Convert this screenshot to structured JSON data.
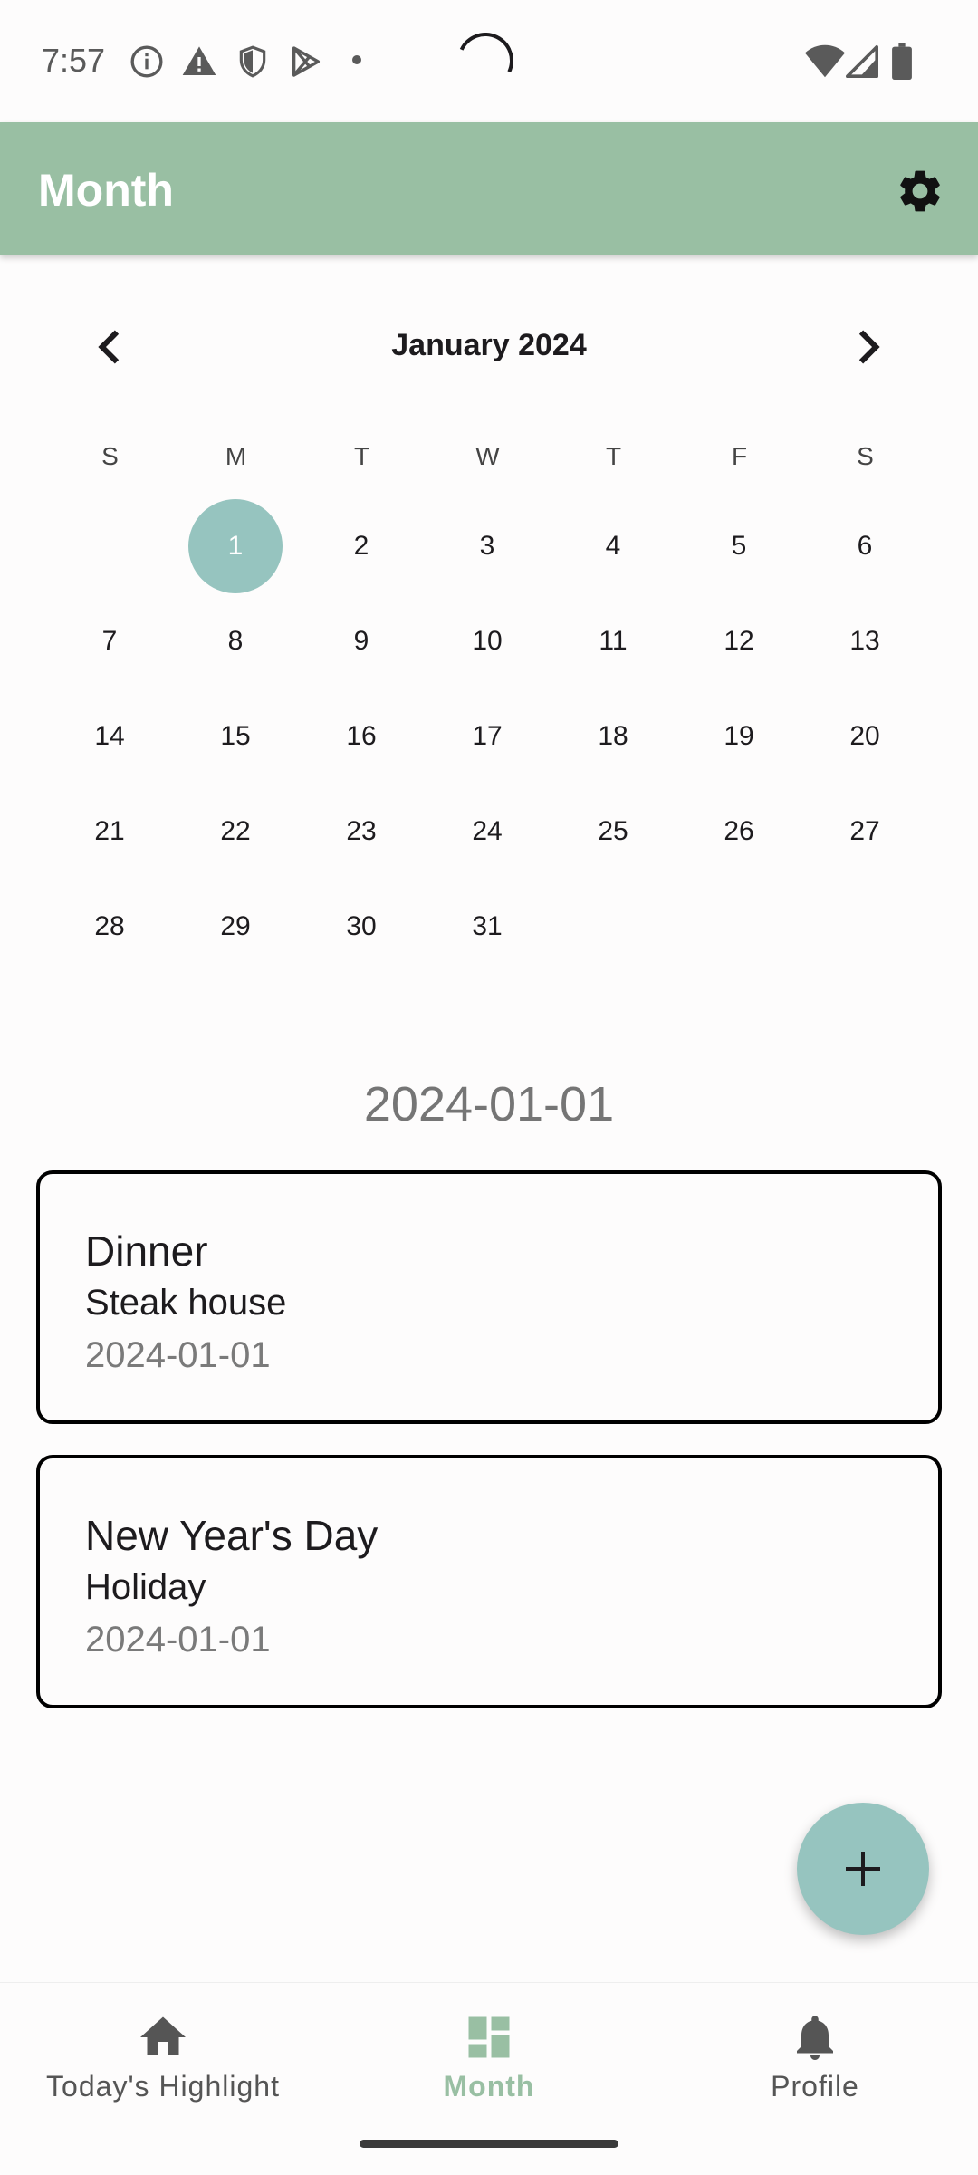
{
  "status": {
    "time": "7:57"
  },
  "app_bar": {
    "title": "Month"
  },
  "calendar": {
    "month_label": "January 2024",
    "weekdays": [
      "S",
      "M",
      "T",
      "W",
      "T",
      "F",
      "S"
    ],
    "weeks": [
      [
        "",
        "1",
        "2",
        "3",
        "4",
        "5",
        "6"
      ],
      [
        "7",
        "8",
        "9",
        "10",
        "11",
        "12",
        "13"
      ],
      [
        "14",
        "15",
        "16",
        "17",
        "18",
        "19",
        "20"
      ],
      [
        "21",
        "22",
        "23",
        "24",
        "25",
        "26",
        "27"
      ],
      [
        "28",
        "29",
        "30",
        "31",
        "",
        "",
        ""
      ]
    ],
    "selected_day": "1",
    "selected_color": "#96c4bf"
  },
  "selected_date": "2024-01-01",
  "events": [
    {
      "title": "Dinner",
      "subtitle": "Steak house",
      "date": "2024-01-01"
    },
    {
      "title": "New Year's Day",
      "subtitle": "Holiday",
      "date": "2024-01-01"
    }
  ],
  "bottom_nav": [
    {
      "label": "Today's Highlight",
      "icon": "home-icon",
      "active": false
    },
    {
      "label": "Month",
      "icon": "dashboard-icon",
      "active": true
    },
    {
      "label": "Profile",
      "icon": "bell-icon",
      "active": false
    }
  ],
  "colors": {
    "app_bar": "#99bfa3",
    "accent": "#96c4bf"
  }
}
